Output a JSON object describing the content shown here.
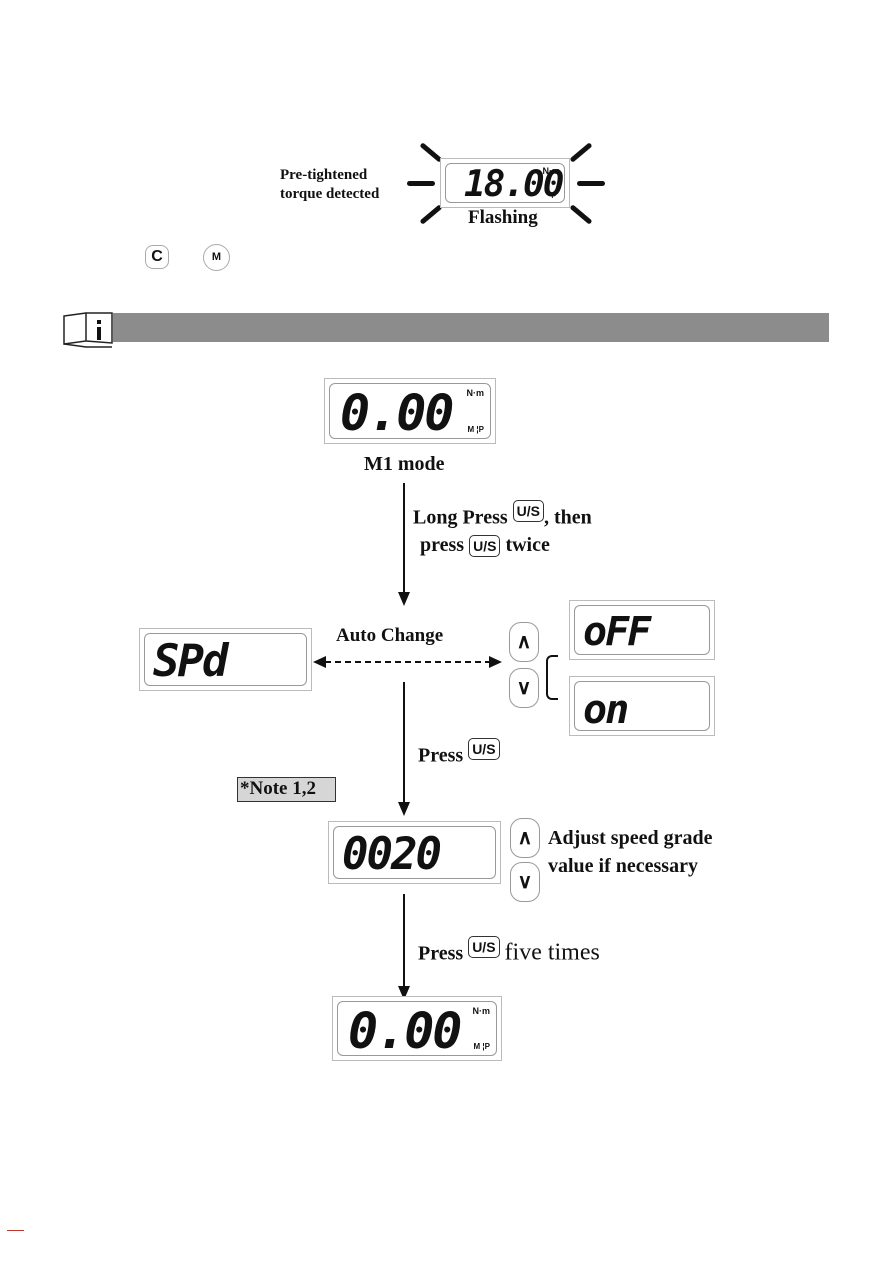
{
  "top_figure": {
    "label": [
      "Pre-tightened",
      "torque detected"
    ],
    "display": {
      "value": "18.00",
      "unit": "N·m",
      "indicator": "P"
    },
    "caption": "Flashing"
  },
  "buttons_row": {
    "c_key": "C",
    "m_key": "M"
  },
  "section_bar": {
    "icon": "info-book-icon",
    "color": "#8c8c8c"
  },
  "flow": {
    "step1": {
      "display": {
        "value": "0.00",
        "unit": "N·m",
        "indicator": "M ¦P"
      },
      "caption": "M1 mode"
    },
    "instr1": {
      "line1_a": "Long Press",
      "key": "U/S",
      "line1_b": ", then",
      "line2_a": "press",
      "line2_b": "twice"
    },
    "step2": {
      "display": "SPd",
      "auto_change": "Auto Change",
      "options": [
        "oFF",
        "on"
      ],
      "up": "∧",
      "down": "∨"
    },
    "instr2": {
      "text": "Press",
      "key": "U/S"
    },
    "note": "*Note 1,2",
    "step3": {
      "display": "0020",
      "adjust": [
        "Adjust speed grade",
        "value if necessary"
      ],
      "up": "∧",
      "down": "∨"
    },
    "instr3": {
      "text": "Press",
      "key": "U/S",
      "suffix": "five times"
    },
    "step4": {
      "display": {
        "value": "0.00",
        "unit": "N·m",
        "indicator": "M ¦P"
      }
    }
  },
  "footer": {
    "accent": "#c0392b"
  }
}
